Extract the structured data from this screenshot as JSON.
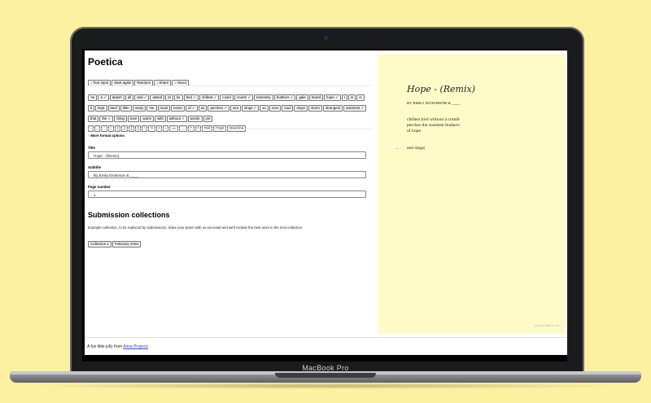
{
  "device": {
    "brand": "MacBook Pro"
  },
  "app": {
    "title": "Poetica",
    "toolbar": [
      "↓ Text input",
      "Start again",
      "Random",
      "↓ Share",
      "↓ About"
    ],
    "word_bank": [
      "'ve",
      "a ✓",
      "abash",
      "all",
      "and ✓",
      "asked",
      "at",
      "be",
      "bird ✓",
      "chillest ✓",
      "could",
      "crumb ✓",
      "extremity",
      "feathers ✓",
      "gale",
      "heard",
      "hope ✓",
      "I",
      "in",
      "is",
      "it",
      "kept",
      "land",
      "little",
      "many",
      "me",
      "must",
      "never",
      "of ✓",
      "on",
      "perches ✓",
      "sea",
      "sings ✓",
      "so",
      "sore",
      "soul",
      "stops",
      "storm",
      "strangest",
      "sweetest ✓",
      "that",
      "the ✓",
      "thing",
      "tune",
      "warm",
      "with",
      "without ✓",
      "words",
      "yet"
    ],
    "punctuation_bank": [
      ".",
      ",",
      ":",
      ";",
      "(",
      ")",
      "[",
      "]",
      "'",
      "?",
      "!",
      "-",
      "—",
      "…",
      "\"",
      "*",
      "Del",
      "Caps",
      "New line"
    ],
    "more_format_label": "↑ More format options",
    "fields": {
      "title_label": "Title",
      "title_value": "Hope - (Remix)",
      "subtitle_label": "Subtitle",
      "subtitle_value": "By Emily Dickinson & ____",
      "page_label": "Page number",
      "page_value": "1"
    },
    "collections": {
      "heading": "Submission collections",
      "description": "Example collection, to be replaced by submissions, share your poem with us via email and we'll include the best ones in the next collection",
      "buttons": [
        "Collection 1",
        "February remix"
      ]
    },
    "footer": {
      "prefix": "A fun little jolly from ",
      "link_text": "Alma Projects"
    }
  },
  "preview": {
    "title": "Hope - (Remix)",
    "subtitle": "BY EMILY DICKINSON & ____",
    "lines": [
      "chillest bird without a crumb",
      "perches the sweetest feathers",
      "of hope"
    ],
    "gap_marker": "...",
    "last_line": "and sings|",
    "credit": "poetica.fdlab.co.uk"
  },
  "colors": {
    "background": "#fbf1a0",
    "preview_paper": "#fffbc9",
    "link": "#3a44cc"
  }
}
